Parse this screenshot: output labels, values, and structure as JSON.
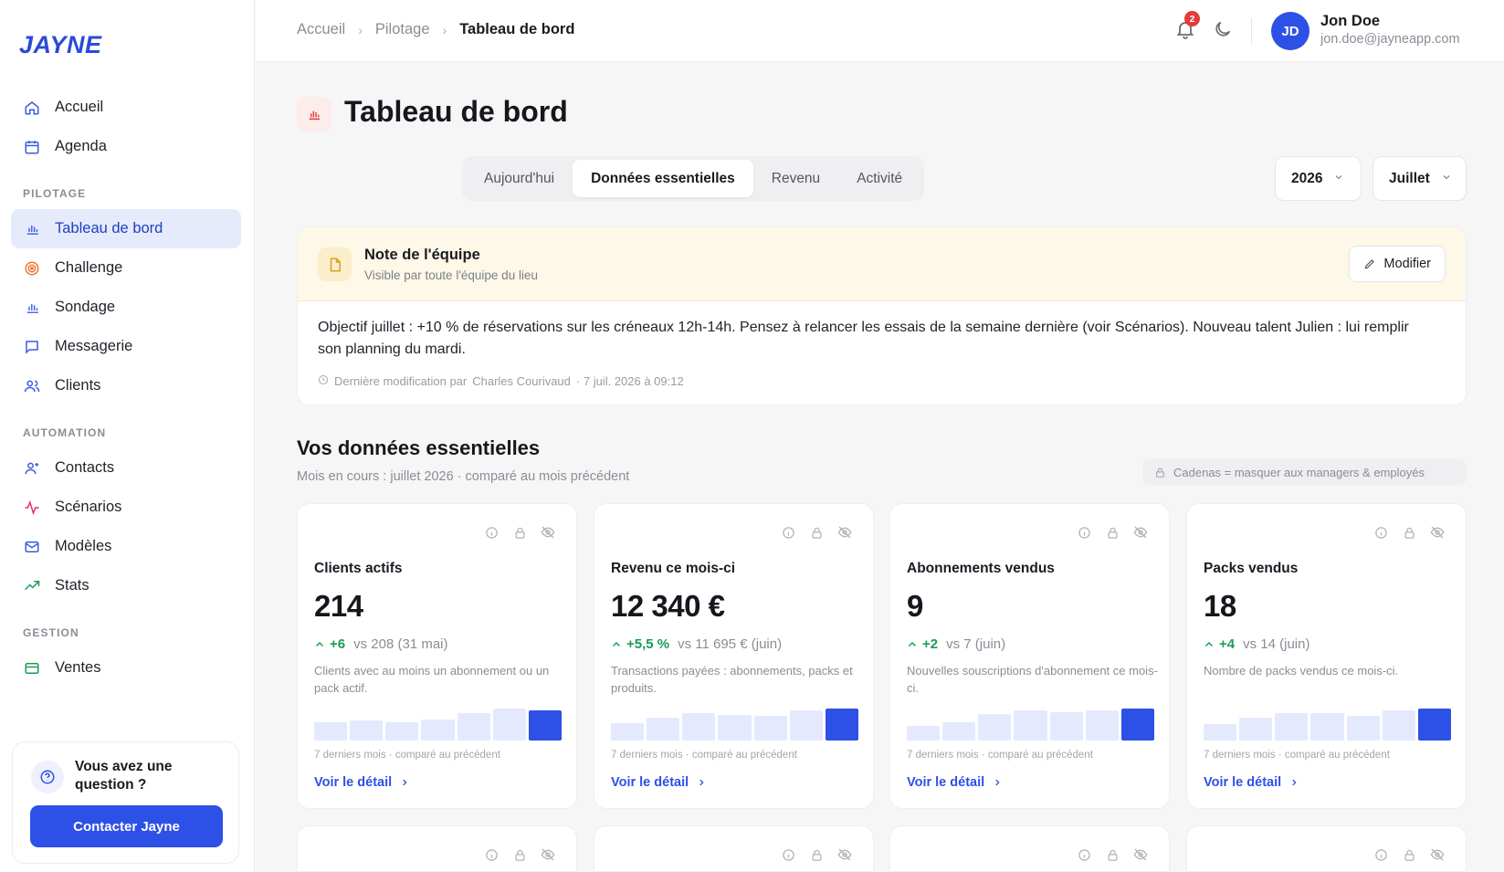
{
  "brand": {
    "logo": "JAYNE",
    "accent": "#2d50e6"
  },
  "sidebar": {
    "items_top": [
      {
        "label": "Accueil",
        "icon": "home-icon"
      },
      {
        "label": "Agenda",
        "icon": "calendar-icon"
      }
    ],
    "sections": [
      {
        "title": "PILOTAGE",
        "items": [
          {
            "label": "Tableau de bord",
            "icon": "bar-chart-icon",
            "active": true
          },
          {
            "label": "Challenge",
            "icon": "target-icon"
          },
          {
            "label": "Sondage",
            "icon": "poll-icon"
          },
          {
            "label": "Messagerie",
            "icon": "message-icon"
          },
          {
            "label": "Clients",
            "icon": "users-icon"
          }
        ]
      },
      {
        "title": "AUTOMATION",
        "items": [
          {
            "label": "Contacts",
            "icon": "contact-icon"
          },
          {
            "label": "Scénarios",
            "icon": "activity-icon"
          },
          {
            "label": "Modèles",
            "icon": "mail-icon"
          },
          {
            "label": "Stats",
            "icon": "trend-icon"
          }
        ]
      },
      {
        "title": "GESTION",
        "items": [
          {
            "label": "Ventes",
            "icon": "card-icon"
          }
        ]
      }
    ],
    "help": {
      "text": "Vous avez une question ?",
      "button": "Contacter Jayne"
    }
  },
  "header": {
    "breadcrumb": [
      "Accueil",
      "Pilotage",
      "Tableau de bord"
    ],
    "notifications": "2",
    "user": {
      "initials": "JD",
      "name": "Jon Doe",
      "email": "jon.doe@jayneapp.com"
    }
  },
  "page": {
    "title": "Tableau de bord",
    "tabs": [
      "Aujourd'hui",
      "Données essentielles",
      "Revenu",
      "Activité"
    ],
    "active_tab": 1,
    "year": "2026",
    "month": "Juillet"
  },
  "note": {
    "title": "Note de l'équipe",
    "subtitle": "Visible par toute l'équipe du lieu",
    "edit": "Modifier",
    "body": "Objectif juillet : +10 % de réservations sur les créneaux 12h-14h. Pensez à relancer les essais de la semaine dernière (voir Scénarios). Nouveau talent Julien : lui remplir son planning du mardi.",
    "meta_prefix": "Dernière modification par",
    "meta_author": "Charles Courivaud",
    "meta_date": "· 7 juil. 2026 à 09:12"
  },
  "essentials": {
    "title": "Vos données essentielles",
    "subtitle": "Mois en cours : juillet 2026 · comparé au mois précédent",
    "lock_hint": "Cadenas = masquer aux managers & employés",
    "cards": [
      {
        "label": "Clients actifs",
        "value": "214",
        "delta": "+6",
        "compare": "vs 208 (31 mai)",
        "desc": "Clients avec au moins un abonnement ou un pack actif.",
        "bars": [
          0.55,
          0.6,
          0.55,
          0.62,
          0.82,
          0.95,
          0.88
        ],
        "foot": "7 derniers mois · comparé au précédent",
        "link": "Voir le détail"
      },
      {
        "label": "Revenu ce mois-ci",
        "value": "12 340 €",
        "delta": "+5,5 %",
        "compare": "vs 11 695 € (juin)",
        "desc": "Transactions payées : abonnements, packs et produits.",
        "bars": [
          0.5,
          0.68,
          0.8,
          0.75,
          0.72,
          0.88,
          0.95
        ],
        "foot": "7 derniers mois · comparé au précédent",
        "link": "Voir le détail"
      },
      {
        "label": "Abonnements vendus",
        "value": "9",
        "delta": "+2",
        "compare": "vs 7 (juin)",
        "desc": "Nouvelles souscriptions d'abonnement ce mois-ci.",
        "bars": [
          0.42,
          0.55,
          0.78,
          0.88,
          0.85,
          0.88,
          0.95
        ],
        "foot": "7 derniers mois · comparé au précédent",
        "link": "Voir le détail"
      },
      {
        "label": "Packs vendus",
        "value": "18",
        "delta": "+4",
        "compare": "vs 14 (juin)",
        "desc": "Nombre de packs vendus ce mois-ci.",
        "bars": [
          0.48,
          0.68,
          0.82,
          0.8,
          0.72,
          0.88,
          0.95
        ],
        "foot": "7 derniers mois · comparé au précédent",
        "link": "Voir le détail"
      }
    ]
  }
}
